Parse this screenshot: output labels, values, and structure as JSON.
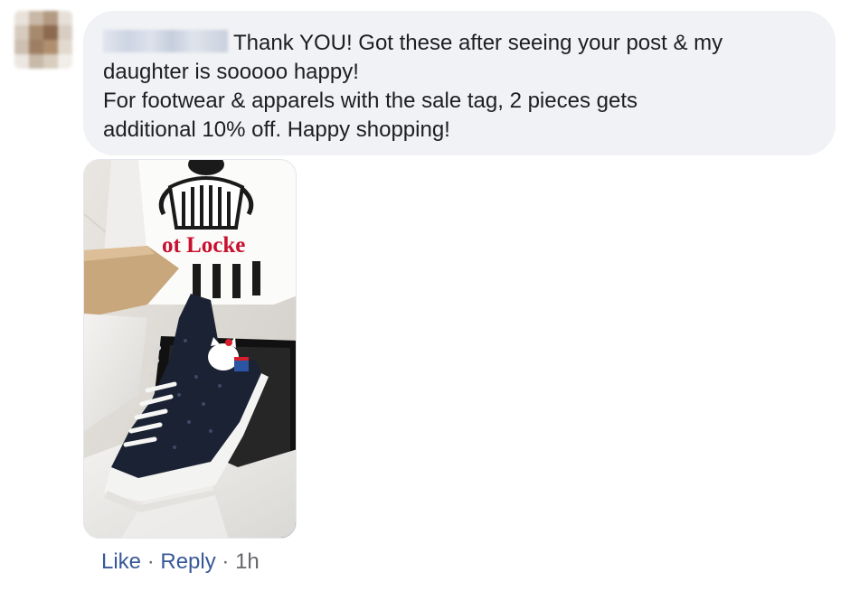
{
  "comment": {
    "author_name": "",
    "text": "Thank YOU! Got these after seeing your post & my\ndaughter is sooooo happy!\nFor footwear & apparels with the sale tag, 2 pieces gets\nadditional 10% off. Happy shopping!",
    "photo_bag_text": "ot Locke"
  },
  "actions": {
    "like_label": "Like",
    "reply_label": "Reply",
    "separator": "·",
    "timestamp": "1h"
  },
  "colors": {
    "bubble_bg": "#f0f2f5",
    "link": "#385898",
    "meta": "#65676b",
    "text": "#1c1e21",
    "bag_logo_red": "#c8102e"
  }
}
